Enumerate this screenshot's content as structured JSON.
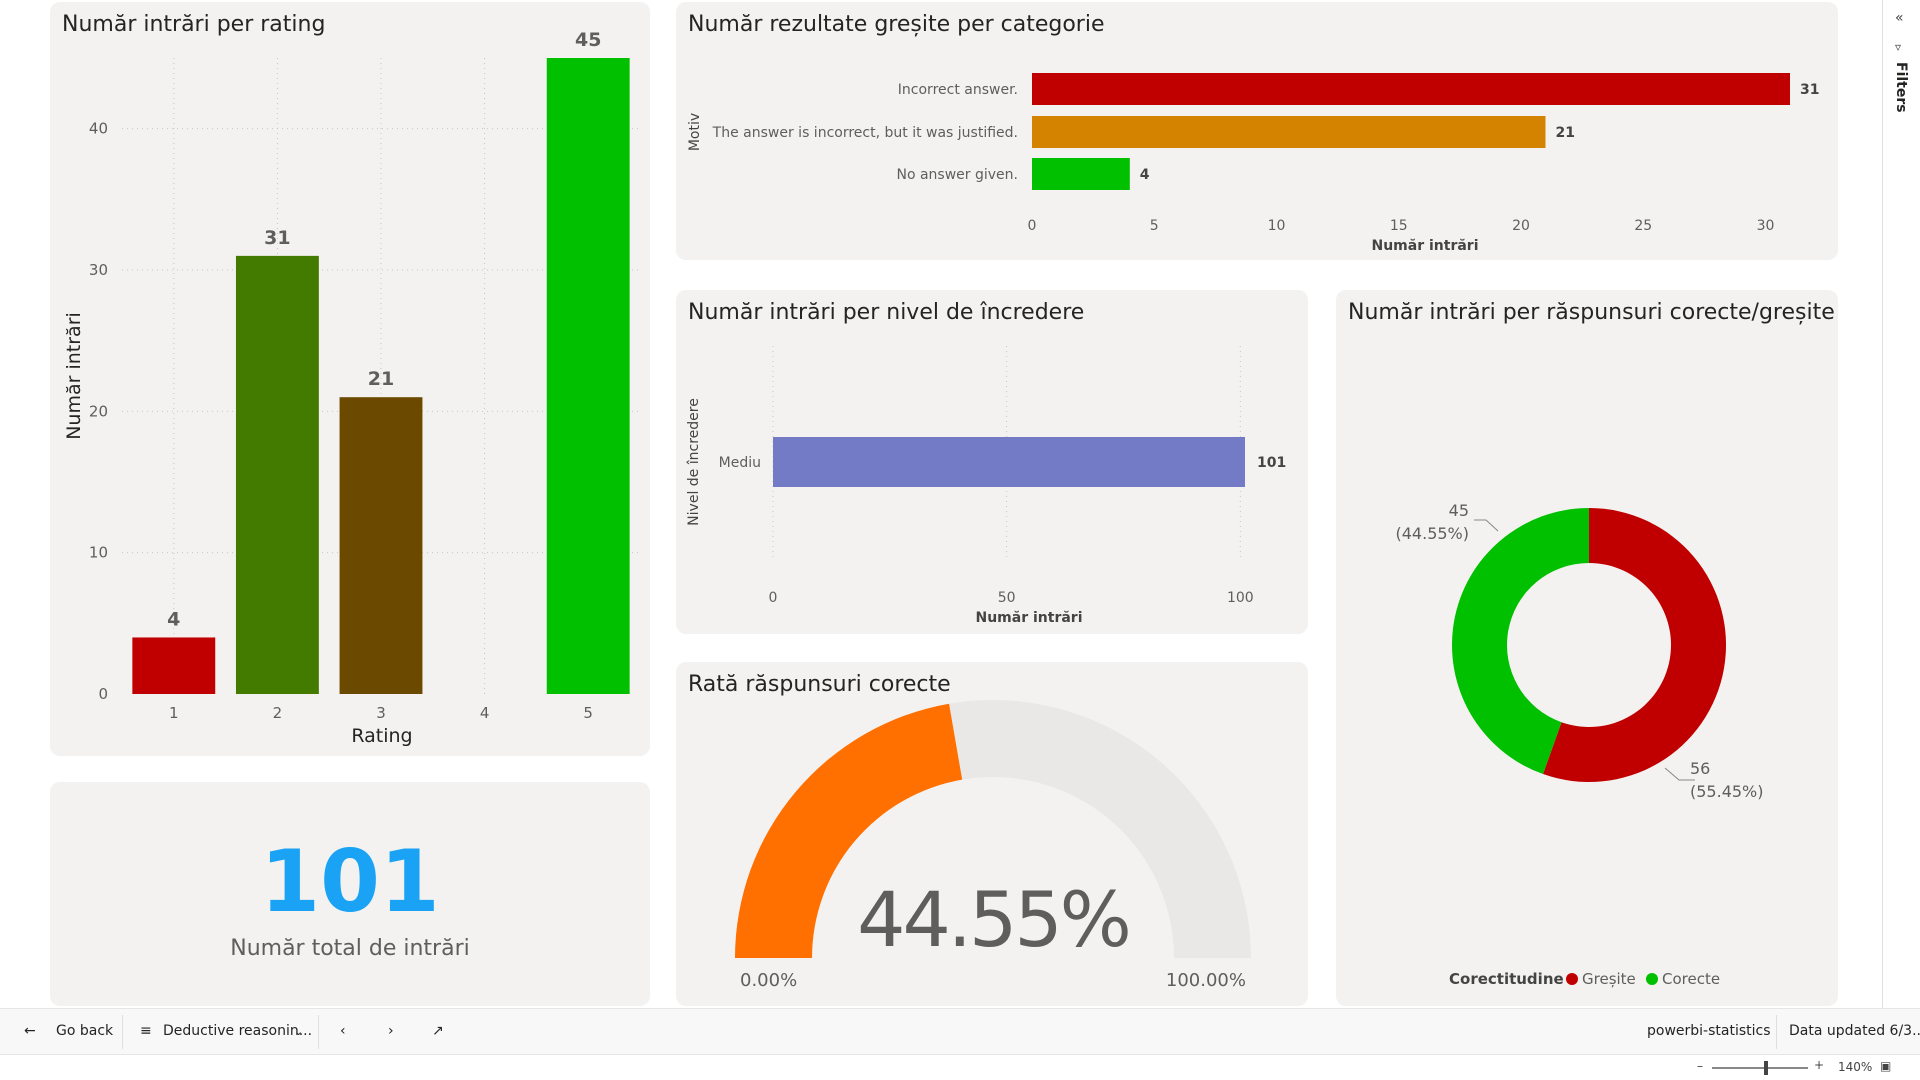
{
  "colors": {
    "red": "#c00000",
    "dark_green": "#437a00",
    "brown": "#6b4a00",
    "bright_green": "#00c000",
    "orange": "#d48300",
    "periwinkle": "#737bc7",
    "gauge_fill": "#ff7000",
    "gauge_bg": "#e9e8e7",
    "kpi_blue": "#1aa3f5"
  },
  "rating_chart": {
    "title": "Număr intrări per rating",
    "xlabel": "Rating",
    "ylabel": "Număr intrări",
    "categories": [
      "1",
      "2",
      "3",
      "4",
      "5"
    ],
    "values": [
      4,
      31,
      21,
      null,
      45
    ],
    "value_labels": [
      "4",
      "31",
      "21",
      "",
      "45"
    ],
    "bar_colors": [
      "#c00000",
      "#437a00",
      "#6b4a00",
      null,
      "#00c000"
    ],
    "ylim": [
      0,
      45
    ],
    "yticks": [
      0,
      10,
      20,
      30,
      40
    ]
  },
  "wrong_chart": {
    "title": "Număr rezultate greșite per categorie",
    "ylabel": "Motiv",
    "xlabel": "Număr intrări",
    "categories": [
      "Incorrect answer.",
      "The answer is incorrect, but it was justified.",
      "No answer given."
    ],
    "values": [
      31,
      21,
      4
    ],
    "bar_colors": [
      "#c00000",
      "#d48300",
      "#00c000"
    ],
    "xlim": [
      0,
      31
    ],
    "xticks": [
      0,
      5,
      10,
      15,
      20,
      25,
      30
    ]
  },
  "confidence_chart": {
    "title": "Număr intrări per nivel de încredere",
    "ylabel": "Nivel de încredere",
    "xlabel": "Număr intrări",
    "categories": [
      "Mediu"
    ],
    "values": [
      101
    ],
    "bar_color": "#737bc7",
    "xlim": [
      0,
      101
    ],
    "xticks": [
      0,
      50,
      100
    ]
  },
  "kpi": {
    "value": "101",
    "label": "Număr total de intrări"
  },
  "gauge": {
    "title": "Rată răspunsuri corecte",
    "value_label": "44.55%",
    "value_fraction": 0.4455,
    "min_label": "0.00%",
    "max_label": "100.00%"
  },
  "donut_chart": {
    "title": "Număr intrări per răspunsuri corecte/greșite",
    "slices": [
      {
        "name": "Greșite",
        "value": 56,
        "label_count": "56",
        "label_pct": "(55.45%)",
        "color": "#c00000"
      },
      {
        "name": "Corecte",
        "value": 45,
        "label_count": "45",
        "label_pct": "(44.55%)",
        "color": "#00c000"
      }
    ],
    "legend_title": "Corectitudine"
  },
  "chart_data": [
    {
      "type": "bar",
      "title": "Număr intrări per rating",
      "categories": [
        "1",
        "2",
        "3",
        "4",
        "5"
      ],
      "values": [
        4,
        31,
        21,
        null,
        45
      ],
      "xlabel": "Rating",
      "ylabel": "Număr intrări",
      "ylim": [
        0,
        45
      ]
    },
    {
      "type": "bar",
      "title": "Număr rezultate greșite per categorie",
      "categories": [
        "Incorrect answer.",
        "The answer is incorrect, but it was justified.",
        "No answer given."
      ],
      "values": [
        31,
        21,
        4
      ],
      "xlabel": "Număr intrări",
      "ylabel": "Motiv"
    },
    {
      "type": "bar",
      "title": "Număr intrări per nivel de încredere",
      "categories": [
        "Mediu"
      ],
      "values": [
        101
      ],
      "xlabel": "Număr intrări",
      "ylabel": "Nivel de încredere"
    },
    {
      "type": "pie",
      "title": "Număr intrări per răspunsuri corecte/greșite",
      "categories": [
        "Greșite",
        "Corecte"
      ],
      "values": [
        56,
        45
      ]
    }
  ],
  "filters": {
    "label": "Filters"
  },
  "bottombar": {
    "back_label": "Go back",
    "page_label": "Deductive reasonin...",
    "workspace_label": "powerbi-statistics",
    "updated_label": "Data updated 6/3..."
  },
  "statusbar": {
    "zoom_label": "140%"
  }
}
